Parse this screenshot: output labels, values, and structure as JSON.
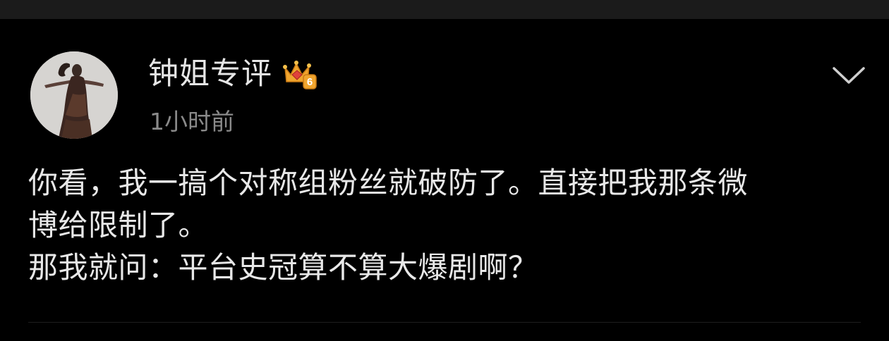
{
  "post": {
    "author": {
      "name": "钟姐专评",
      "badge_level": "6",
      "badge_icon": "crown-badge-icon",
      "avatar_icon": "avatar-portrait"
    },
    "timestamp": "1小时前",
    "menu_icon": "chevron-down-icon",
    "text_lines": [
      "你看，我一搞个对称组粉丝就破防了。直接把我那条微",
      "博给限制了。",
      "那我就问：平台史冠算不算大爆剧啊？"
    ]
  },
  "colors": {
    "background": "#000000",
    "topbar": "#1b1b1b",
    "username": "#e6e6e6",
    "timestamp": "#8a8a8a",
    "body_text": "#e8e8e8",
    "badge_gold": "#f0a52e",
    "badge_red": "#e0413b"
  }
}
